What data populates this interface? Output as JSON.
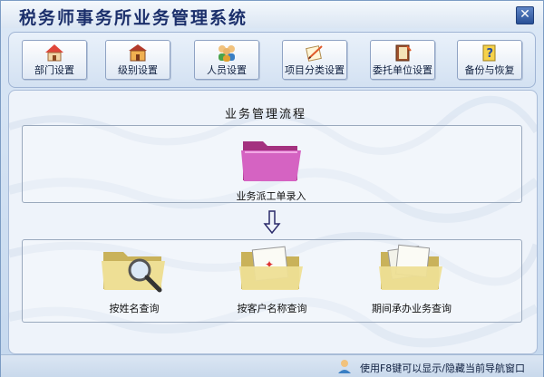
{
  "window": {
    "title": "税务师事务所业务管理系统",
    "close_glyph": "✕"
  },
  "toolbar": [
    {
      "label": "部门设置",
      "icon": "house-icon"
    },
    {
      "label": "级别设置",
      "icon": "building-icon"
    },
    {
      "label": "人员设置",
      "icon": "people-icon"
    },
    {
      "label": "项目分类设置",
      "icon": "pencil-doc-icon"
    },
    {
      "label": "委托单位设置",
      "icon": "notebook-icon"
    },
    {
      "label": "备份与恢复",
      "icon": "help-doc-icon"
    }
  ],
  "main": {
    "section_title": "业务管理流程",
    "primary": {
      "label": "业务派工单录入",
      "icon": "pink-folder-icon"
    },
    "queries": [
      {
        "label": "按姓名查询",
        "icon": "folder-magnifier-icon"
      },
      {
        "label": "按客户名称查询",
        "icon": "folder-document-icon"
      },
      {
        "label": "期间承办业务查询",
        "icon": "folder-documents-icon"
      }
    ]
  },
  "status": {
    "hint": "使用F8键可以显示/隐藏当前导航窗口"
  },
  "colors": {
    "title": "#1b2f6b",
    "accent_folder_pink": "#c85bb8",
    "folder_yellow": "#e9d78a"
  }
}
